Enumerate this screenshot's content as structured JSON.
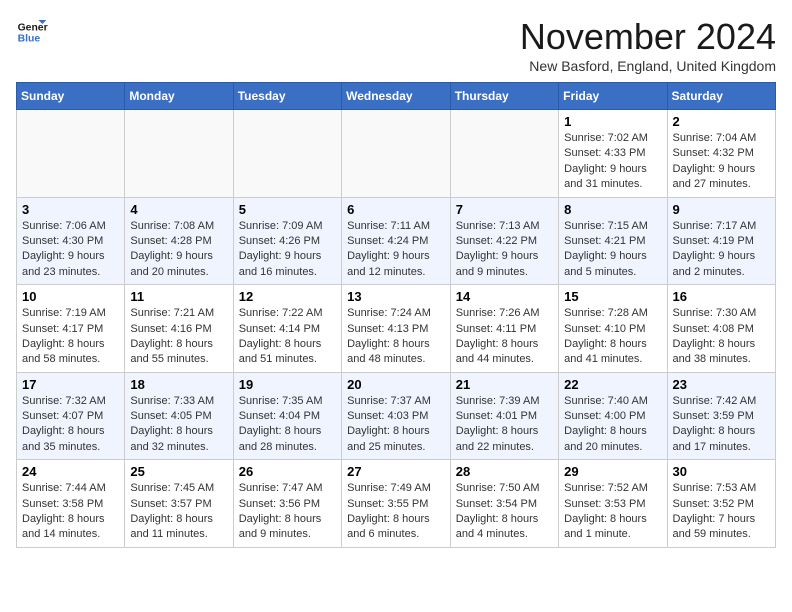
{
  "logo": {
    "line1": "General",
    "line2": "Blue"
  },
  "title": "November 2024",
  "location": "New Basford, England, United Kingdom",
  "weekdays": [
    "Sunday",
    "Monday",
    "Tuesday",
    "Wednesday",
    "Thursday",
    "Friday",
    "Saturday"
  ],
  "weeks": [
    [
      {
        "day": "",
        "info": ""
      },
      {
        "day": "",
        "info": ""
      },
      {
        "day": "",
        "info": ""
      },
      {
        "day": "",
        "info": ""
      },
      {
        "day": "",
        "info": ""
      },
      {
        "day": "1",
        "info": "Sunrise: 7:02 AM\nSunset: 4:33 PM\nDaylight: 9 hours and 31 minutes."
      },
      {
        "day": "2",
        "info": "Sunrise: 7:04 AM\nSunset: 4:32 PM\nDaylight: 9 hours and 27 minutes."
      }
    ],
    [
      {
        "day": "3",
        "info": "Sunrise: 7:06 AM\nSunset: 4:30 PM\nDaylight: 9 hours and 23 minutes."
      },
      {
        "day": "4",
        "info": "Sunrise: 7:08 AM\nSunset: 4:28 PM\nDaylight: 9 hours and 20 minutes."
      },
      {
        "day": "5",
        "info": "Sunrise: 7:09 AM\nSunset: 4:26 PM\nDaylight: 9 hours and 16 minutes."
      },
      {
        "day": "6",
        "info": "Sunrise: 7:11 AM\nSunset: 4:24 PM\nDaylight: 9 hours and 12 minutes."
      },
      {
        "day": "7",
        "info": "Sunrise: 7:13 AM\nSunset: 4:22 PM\nDaylight: 9 hours and 9 minutes."
      },
      {
        "day": "8",
        "info": "Sunrise: 7:15 AM\nSunset: 4:21 PM\nDaylight: 9 hours and 5 minutes."
      },
      {
        "day": "9",
        "info": "Sunrise: 7:17 AM\nSunset: 4:19 PM\nDaylight: 9 hours and 2 minutes."
      }
    ],
    [
      {
        "day": "10",
        "info": "Sunrise: 7:19 AM\nSunset: 4:17 PM\nDaylight: 8 hours and 58 minutes."
      },
      {
        "day": "11",
        "info": "Sunrise: 7:21 AM\nSunset: 4:16 PM\nDaylight: 8 hours and 55 minutes."
      },
      {
        "day": "12",
        "info": "Sunrise: 7:22 AM\nSunset: 4:14 PM\nDaylight: 8 hours and 51 minutes."
      },
      {
        "day": "13",
        "info": "Sunrise: 7:24 AM\nSunset: 4:13 PM\nDaylight: 8 hours and 48 minutes."
      },
      {
        "day": "14",
        "info": "Sunrise: 7:26 AM\nSunset: 4:11 PM\nDaylight: 8 hours and 44 minutes."
      },
      {
        "day": "15",
        "info": "Sunrise: 7:28 AM\nSunset: 4:10 PM\nDaylight: 8 hours and 41 minutes."
      },
      {
        "day": "16",
        "info": "Sunrise: 7:30 AM\nSunset: 4:08 PM\nDaylight: 8 hours and 38 minutes."
      }
    ],
    [
      {
        "day": "17",
        "info": "Sunrise: 7:32 AM\nSunset: 4:07 PM\nDaylight: 8 hours and 35 minutes."
      },
      {
        "day": "18",
        "info": "Sunrise: 7:33 AM\nSunset: 4:05 PM\nDaylight: 8 hours and 32 minutes."
      },
      {
        "day": "19",
        "info": "Sunrise: 7:35 AM\nSunset: 4:04 PM\nDaylight: 8 hours and 28 minutes."
      },
      {
        "day": "20",
        "info": "Sunrise: 7:37 AM\nSunset: 4:03 PM\nDaylight: 8 hours and 25 minutes."
      },
      {
        "day": "21",
        "info": "Sunrise: 7:39 AM\nSunset: 4:01 PM\nDaylight: 8 hours and 22 minutes."
      },
      {
        "day": "22",
        "info": "Sunrise: 7:40 AM\nSunset: 4:00 PM\nDaylight: 8 hours and 20 minutes."
      },
      {
        "day": "23",
        "info": "Sunrise: 7:42 AM\nSunset: 3:59 PM\nDaylight: 8 hours and 17 minutes."
      }
    ],
    [
      {
        "day": "24",
        "info": "Sunrise: 7:44 AM\nSunset: 3:58 PM\nDaylight: 8 hours and 14 minutes."
      },
      {
        "day": "25",
        "info": "Sunrise: 7:45 AM\nSunset: 3:57 PM\nDaylight: 8 hours and 11 minutes."
      },
      {
        "day": "26",
        "info": "Sunrise: 7:47 AM\nSunset: 3:56 PM\nDaylight: 8 hours and 9 minutes."
      },
      {
        "day": "27",
        "info": "Sunrise: 7:49 AM\nSunset: 3:55 PM\nDaylight: 8 hours and 6 minutes."
      },
      {
        "day": "28",
        "info": "Sunrise: 7:50 AM\nSunset: 3:54 PM\nDaylight: 8 hours and 4 minutes."
      },
      {
        "day": "29",
        "info": "Sunrise: 7:52 AM\nSunset: 3:53 PM\nDaylight: 8 hours and 1 minute."
      },
      {
        "day": "30",
        "info": "Sunrise: 7:53 AM\nSunset: 3:52 PM\nDaylight: 7 hours and 59 minutes."
      }
    ]
  ]
}
